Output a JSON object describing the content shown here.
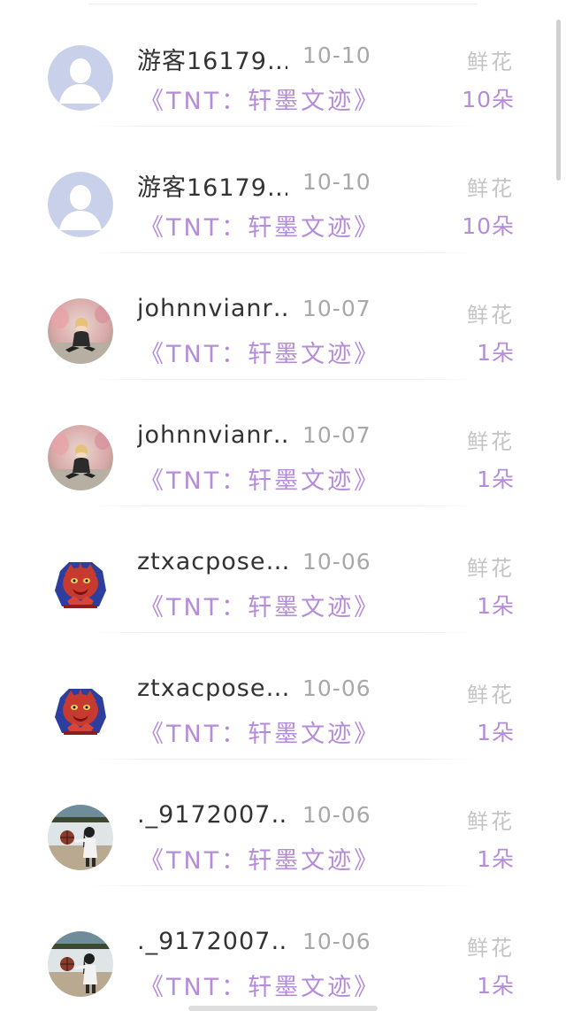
{
  "gift_list": {
    "rows": [
      {
        "user": "游客16179…",
        "date": "10-10",
        "book": "《TNT：轩墨文迹》",
        "gift_type": "鲜花",
        "count": "10朵",
        "avatar": "default-avatar"
      },
      {
        "user": "游客16179…",
        "date": "10-10",
        "book": "《TNT：轩墨文迹》",
        "gift_type": "鲜花",
        "count": "10朵",
        "avatar": "default-avatar"
      },
      {
        "user": "johnnvianr…",
        "date": "10-07",
        "book": "《TNT：轩墨文迹》",
        "gift_type": "鲜花",
        "count": "1朵",
        "avatar": "photo-avatar-girl"
      },
      {
        "user": "johnnvianr…",
        "date": "10-07",
        "book": "《TNT：轩墨文迹》",
        "gift_type": "鲜花",
        "count": "1朵",
        "avatar": "photo-avatar-girl"
      },
      {
        "user": "ztxacpose…",
        "date": "10-06",
        "book": "《TNT：轩墨文迹》",
        "gift_type": "鲜花",
        "count": "1朵",
        "avatar": "lion-mascot-avatar"
      },
      {
        "user": "ztxacpose…",
        "date": "10-06",
        "book": "《TNT：轩墨文迹》",
        "gift_type": "鲜花",
        "count": "1朵",
        "avatar": "lion-mascot-avatar"
      },
      {
        "user": "._9172007…",
        "date": "10-06",
        "book": "《TNT：轩墨文迹》",
        "gift_type": "鲜花",
        "count": "1朵",
        "avatar": "basketball-girl-avatar"
      },
      {
        "user": "._9172007…",
        "date": "10-06",
        "book": "《TNT：轩墨文迹》",
        "gift_type": "鲜花",
        "count": "1朵",
        "avatar": "basketball-girl-avatar"
      }
    ]
  },
  "colors": {
    "accent_purple": "#b48cd9",
    "name_text": "#333333",
    "muted_text": "#a8a8a8",
    "default_avatar_bg": "#c9d1ea"
  }
}
